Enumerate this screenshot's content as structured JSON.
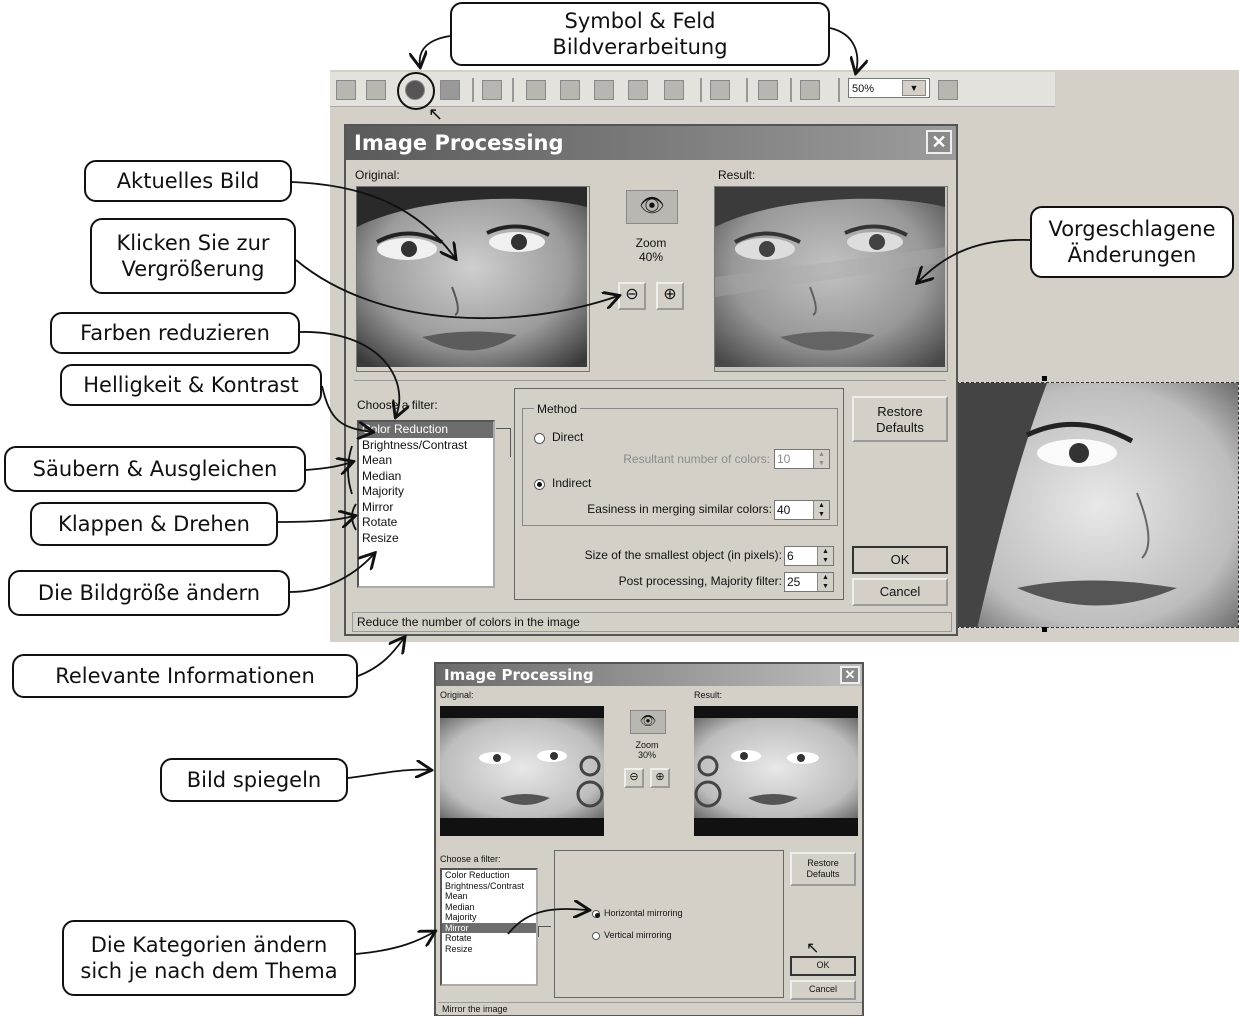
{
  "callouts": {
    "symbol_feld": "Symbol & Feld\nBildverarbeitung",
    "aktuelles_bild": "Aktuelles Bild",
    "klicken": "Klicken Sie zur\nVergrößerung",
    "vorgeschlagene": "Vorgeschlagene\nÄnderungen",
    "farben": "Farben reduzieren",
    "helligkeit": "Helligkeit & Kontrast",
    "saeubern": "Säubern & Ausgleichen",
    "klappen": "Klappen & Drehen",
    "bildgroesse": "Die Bildgröße ändern",
    "relevante": "Relevante Informationen",
    "spiegeln": "Bild spiegeln",
    "kategorien": "Die Kategorien ändern\nsich je nach dem Thema"
  },
  "toolbar": {
    "zoom_value": "50%",
    "icons": [
      "save-icon",
      "print-icon",
      "image-processing-icon",
      "down-arrow-icon",
      "page-icon",
      "cut-icon",
      "copy-icon",
      "paste-icon",
      "paste-special-icon",
      "delete-icon",
      "select-icon",
      "undo-icon",
      "lock-icon",
      "ruler-icon"
    ]
  },
  "dialog1": {
    "title": "Image Processing",
    "close": "✕",
    "original_label": "Original:",
    "result_label": "Result:",
    "zoom_label": "Zoom",
    "zoom_value": "40%",
    "choose_filter": "Choose a filter:",
    "filters": [
      "Color Reduction",
      "Brightness/Contrast",
      "Mean",
      "Median",
      "Majority",
      "Mirror",
      "Rotate",
      "Resize"
    ],
    "selected_filter": 0,
    "method_title": "Method",
    "direct": "Direct",
    "resultant_label": "Resultant number of colors:",
    "resultant_value": "10",
    "indirect": "Indirect",
    "easiness_label": "Easiness in merging similar colors:",
    "easiness_value": "40",
    "smallest_label": "Size of the smallest object (in pixels):",
    "smallest_value": "6",
    "post_label": "Post processing, Majority filter:",
    "post_value": "25",
    "restore": "Restore\nDefaults",
    "ok": "OK",
    "cancel": "Cancel",
    "status": "Reduce the number of colors in the image"
  },
  "dialog2": {
    "title": "Image Processing",
    "close": "✕",
    "original_label": "Original:",
    "result_label": "Result:",
    "zoom_label": "Zoom",
    "zoom_value": "30%",
    "choose_filter": "Choose a filter:",
    "filters": [
      "Color Reduction",
      "Brightness/Contrast",
      "Mean",
      "Median",
      "Majority",
      "Mirror",
      "Rotate",
      "Resize"
    ],
    "selected_filter": 5,
    "horizontal": "Horizontal mirroring",
    "vertical": "Vertical mirroring",
    "restore": "Restore\nDefaults",
    "ok": "OK",
    "cancel": "Cancel",
    "status": "Mirror the image"
  },
  "colors": {
    "title_bar": "#6e6e6e",
    "selection": "#6d6d6d",
    "dialog_bg": "#d4d0c8"
  }
}
